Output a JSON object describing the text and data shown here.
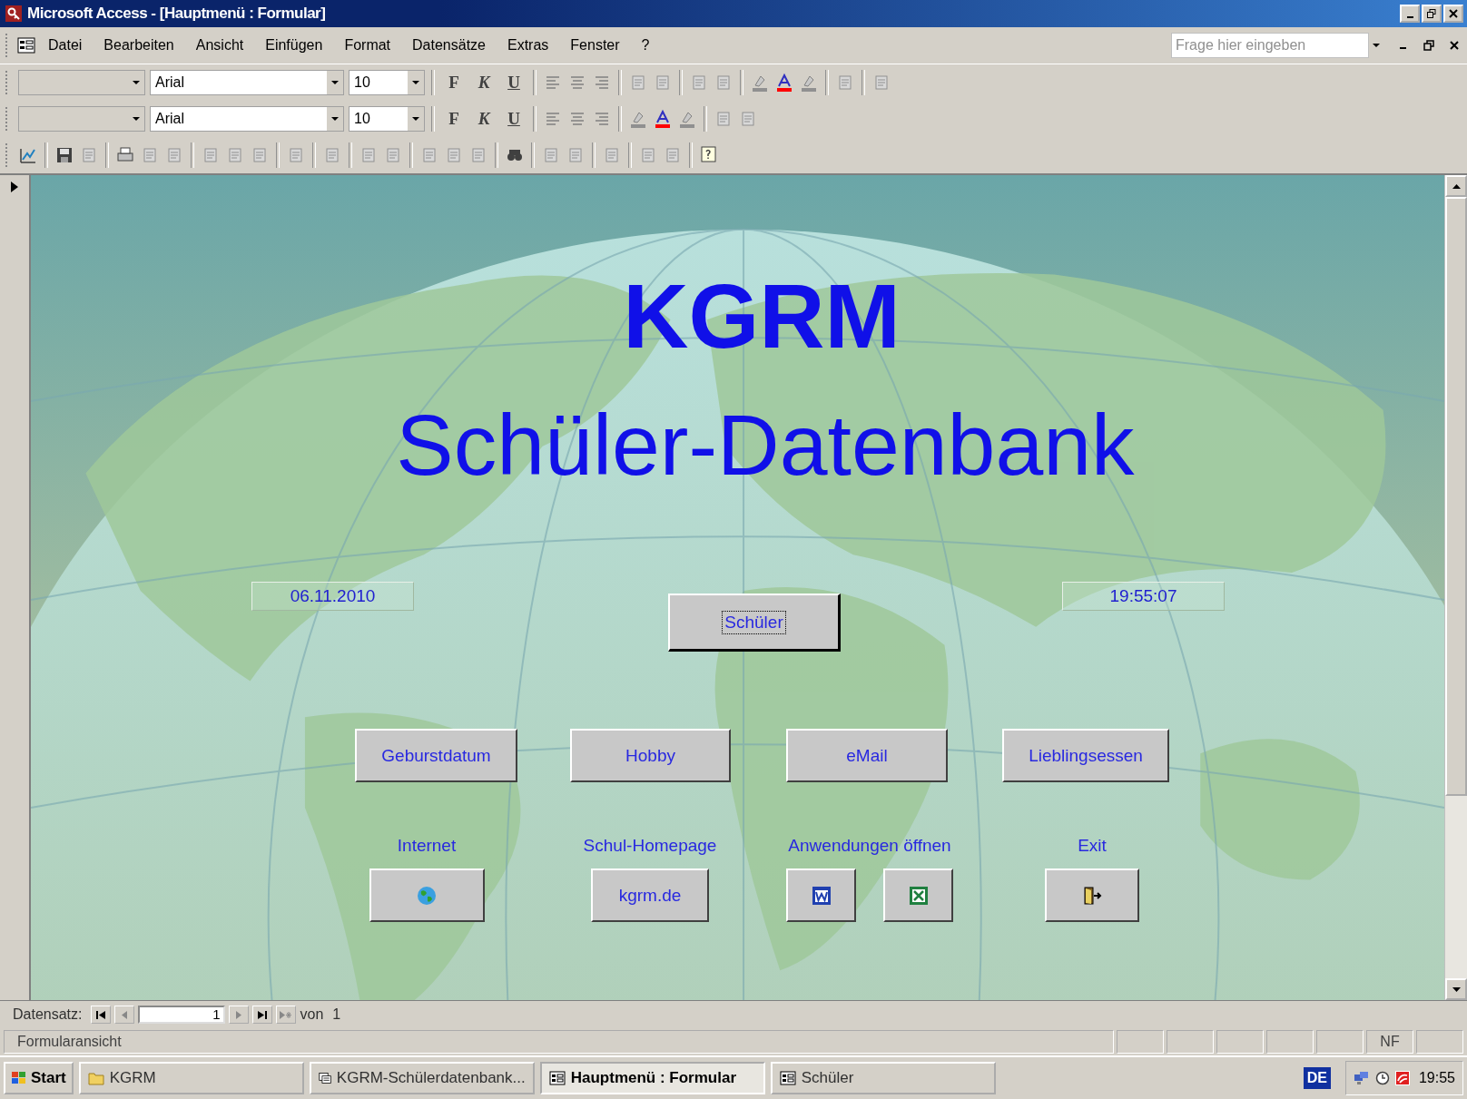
{
  "window": {
    "title": "Microsoft Access - [Hauptmenü : Formular]"
  },
  "menu": [
    "Datei",
    "Bearbeiten",
    "Ansicht",
    "Einfügen",
    "Format",
    "Datensätze",
    "Extras",
    "Fenster",
    "?"
  ],
  "help_box": {
    "placeholder": "Frage hier eingeben"
  },
  "toolbars": [
    {
      "font": "Arial",
      "size": "10",
      "bold": "F",
      "italic": "K",
      "underline": "U"
    },
    {
      "font": "Arial",
      "size": "10",
      "bold": "F",
      "italic": "K",
      "underline": "U"
    }
  ],
  "form": {
    "title": "KGRM",
    "subtitle": "Schüler-Datenbank",
    "date": "06.11.2010",
    "time": "19:55:07",
    "main_button": {
      "label": "Schüler",
      "focused": true
    },
    "buttons": [
      "Geburstdatum",
      "Hobby",
      "eMail",
      "Lieblingsessen"
    ],
    "launchers": [
      {
        "label": "Internet",
        "buttons": [
          {
            "kind": "globe"
          }
        ]
      },
      {
        "label": "Schul-Homepage",
        "buttons": [
          {
            "kind": "text",
            "text": "kgrm.de"
          }
        ]
      },
      {
        "label": "Anwendungen öffnen",
        "buttons": [
          {
            "kind": "word"
          },
          {
            "kind": "excel"
          }
        ]
      },
      {
        "label": "Exit",
        "buttons": [
          {
            "kind": "door"
          }
        ]
      }
    ]
  },
  "navigation": {
    "label": "Datensatz:",
    "record": "1",
    "of_label": "von",
    "total": "1"
  },
  "status_bar": {
    "text": "Formularansicht",
    "indicator": "NF"
  },
  "taskbar": {
    "start": "Start",
    "tasks": [
      {
        "label": "KGRM",
        "kind": "folder",
        "selected": false
      },
      {
        "label": "KGRM-Schülerdatenbank...",
        "kind": "database",
        "selected": false
      },
      {
        "label": "Hauptmenü : Formular",
        "kind": "form",
        "selected": true
      },
      {
        "label": "Schüler",
        "kind": "form",
        "selected": false
      }
    ],
    "language": "DE",
    "clock": "19:55"
  }
}
